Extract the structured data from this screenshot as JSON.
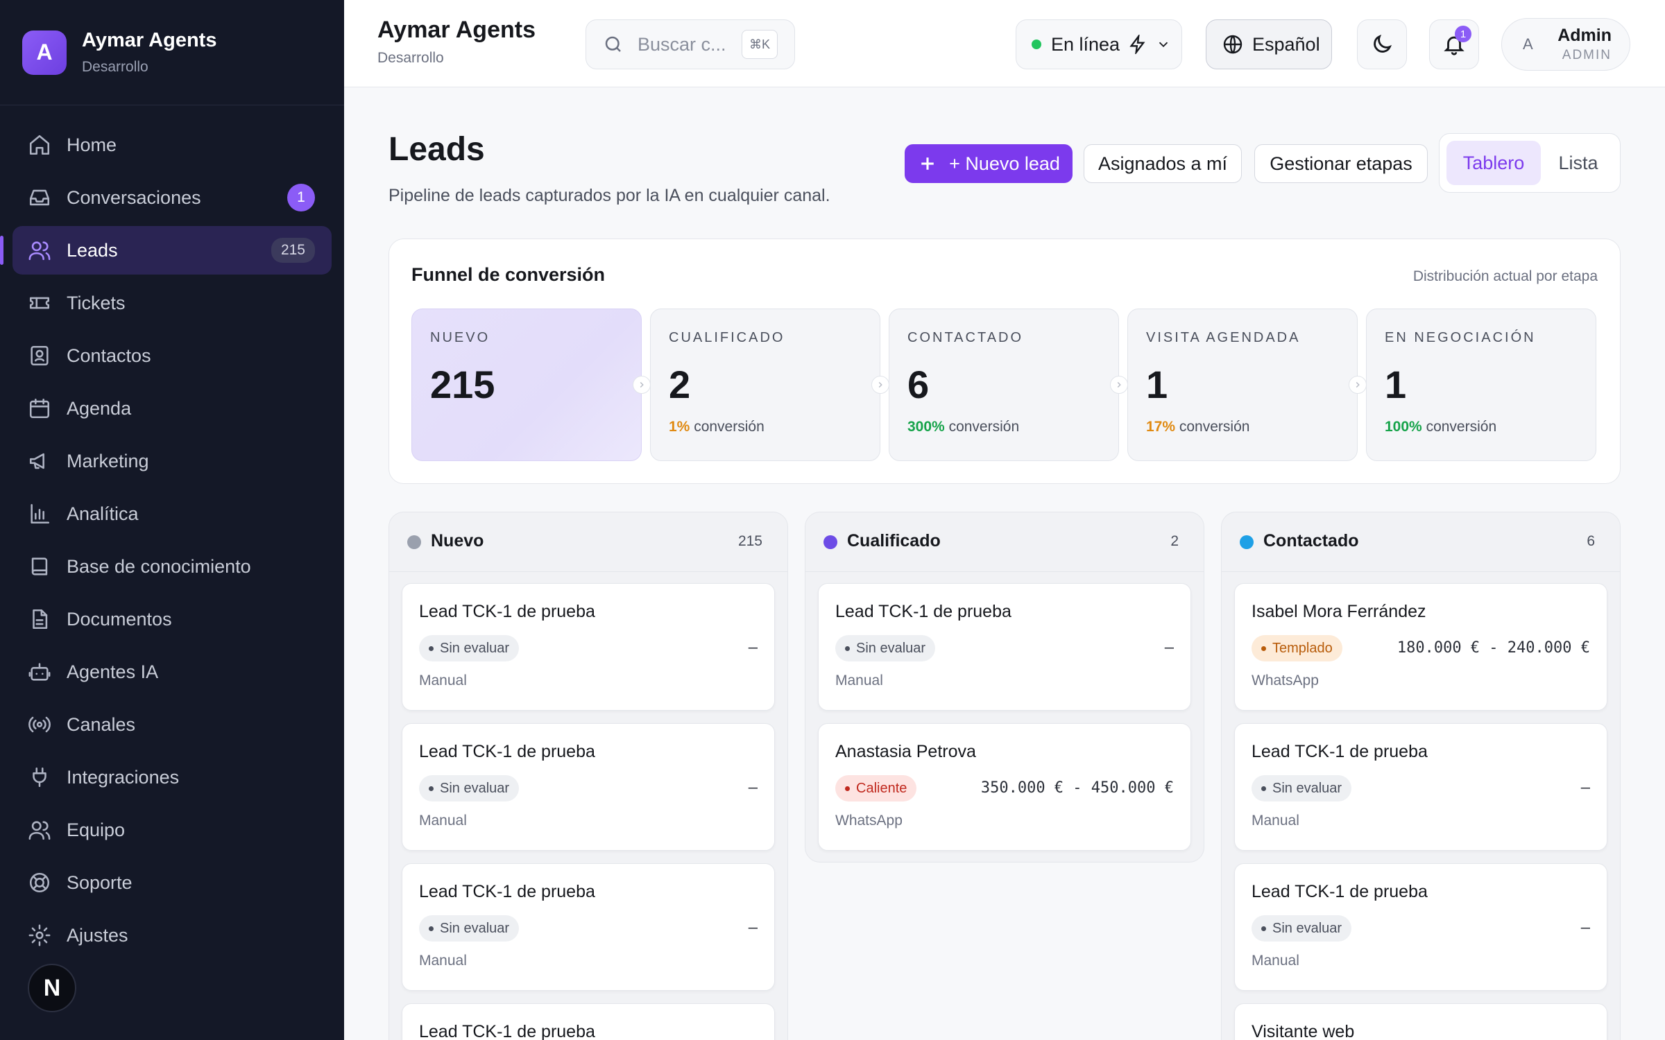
{
  "sidebar": {
    "brand_initial": "A",
    "brand_title": "Aymar Agents",
    "brand_sub": "Desarrollo",
    "items": [
      {
        "label": "Home",
        "icon": "home-icon"
      },
      {
        "label": "Conversaciones",
        "icon": "inbox-icon",
        "badge": "1"
      },
      {
        "label": "Leads",
        "icon": "users-icon",
        "badge": "215",
        "active": true
      },
      {
        "label": "Tickets",
        "icon": "ticket-icon"
      },
      {
        "label": "Contactos",
        "icon": "contact-icon"
      },
      {
        "label": "Agenda",
        "icon": "calendar-icon"
      },
      {
        "label": "Marketing",
        "icon": "megaphone-icon"
      },
      {
        "label": "Analítica",
        "icon": "bar-chart-icon"
      },
      {
        "label": "Base de conocimiento",
        "icon": "book-icon"
      },
      {
        "label": "Documentos",
        "icon": "file-icon"
      },
      {
        "label": "Agentes IA",
        "icon": "bot-icon"
      },
      {
        "label": "Canales",
        "icon": "radio-icon"
      },
      {
        "label": "Integraciones",
        "icon": "plug-icon"
      },
      {
        "label": "Equipo",
        "icon": "team-icon"
      },
      {
        "label": "Soporte",
        "icon": "lifebuoy-icon"
      },
      {
        "label": "Ajustes",
        "icon": "gear-icon"
      }
    ],
    "footer_logo": "N"
  },
  "header": {
    "title": "Aymar Agents",
    "subtitle": "Desarrollo",
    "search_placeholder": "Buscar c...",
    "search_shortcut": "⌘K",
    "status": "En línea",
    "language": "Español",
    "notifications": "1",
    "user_initial": "A",
    "user_name": "Admin",
    "user_role": "ADMIN"
  },
  "page": {
    "title": "Leads",
    "subtitle": "Pipeline de leads capturados por la IA en cualquier canal.",
    "new_lead": "+ Nuevo lead",
    "assigned": "Asignados a mí",
    "manage": "Gestionar etapas",
    "view_board": "Tablero",
    "view_list": "Lista"
  },
  "funnel": {
    "title": "Funnel de conversión",
    "hint": "Distribución actual por etapa",
    "conv_label": "conversión",
    "stages": [
      {
        "label": "NUEVO",
        "value": "215",
        "pct": "",
        "color": "#8b5cf6"
      },
      {
        "label": "CUALIFICADO",
        "value": "2",
        "pct": "1%",
        "color": "#e08a12"
      },
      {
        "label": "CONTACTADO",
        "value": "6",
        "pct": "300%",
        "color": "#16a34a"
      },
      {
        "label": "VISITA AGENDADA",
        "value": "1",
        "pct": "17%",
        "color": "#e08a12"
      },
      {
        "label": "EN NEGOCIACIÓN",
        "value": "1",
        "pct": "100%",
        "color": "#16a34a"
      }
    ]
  },
  "columns": [
    {
      "title": "Nuevo",
      "count": "215",
      "color": "#9aa0ad",
      "cards": [
        {
          "name": "Lead TCK-1 de prueba",
          "tag": "Sin evaluar",
          "amount": "—",
          "source": "Manual"
        },
        {
          "name": "Lead TCK-1 de prueba",
          "tag": "Sin evaluar",
          "amount": "—",
          "source": "Manual"
        },
        {
          "name": "Lead TCK-1 de prueba",
          "tag": "Sin evaluar",
          "amount": "—",
          "source": "Manual"
        },
        {
          "name": "Lead TCK-1 de prueba"
        }
      ]
    },
    {
      "title": "Cualificado",
      "count": "2",
      "color": "#6d4ce6",
      "cards": [
        {
          "name": "Lead TCK-1 de prueba",
          "tag": "Sin evaluar",
          "amount": "—",
          "source": "Manual"
        },
        {
          "name": "Anastasia Petrova",
          "tag": "Caliente",
          "amount": "350.000 € - 450.000 €",
          "source": "WhatsApp"
        }
      ]
    },
    {
      "title": "Contactado",
      "count": "6",
      "color": "#1ea0e6",
      "cards": [
        {
          "name": "Isabel Mora Ferrández",
          "tag": "Templado",
          "amount": "180.000 € - 240.000 €",
          "source": "WhatsApp"
        },
        {
          "name": "Lead TCK-1 de prueba",
          "tag": "Sin evaluar",
          "amount": "—",
          "source": "Manual"
        },
        {
          "name": "Lead TCK-1 de prueba",
          "tag": "Sin evaluar",
          "amount": "—",
          "source": "Manual"
        },
        {
          "name": "Visitante web"
        }
      ]
    }
  ]
}
